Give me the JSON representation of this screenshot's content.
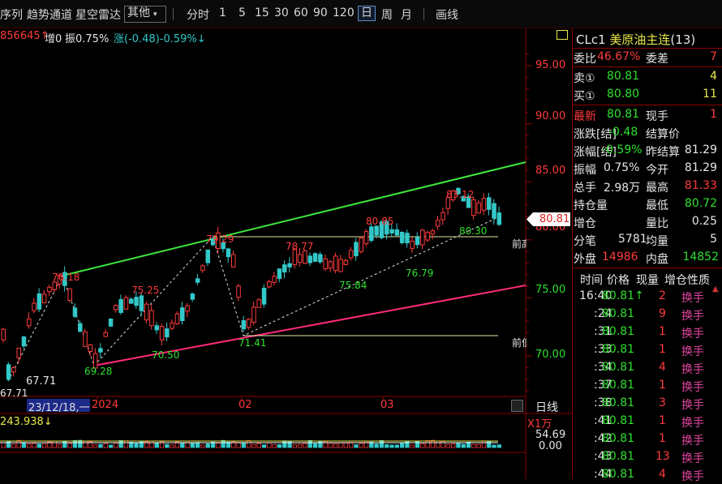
{
  "toolbar": {
    "items": [
      "序列",
      "趋势通道",
      "星空雷达"
    ],
    "other_select": "其他",
    "periods": [
      "分时",
      "1",
      "5",
      "15",
      "30",
      "60",
      "90",
      "120",
      "日",
      "周",
      "月"
    ],
    "selected_period": "日",
    "draw_label": "画线"
  },
  "info_bar": {
    "vol_label": "856645↑",
    "inc_label": "增0",
    "amp_label": "振0.75%",
    "chg_label": "涨(-0.48)-0.59%↓"
  },
  "price_axis": [
    "95.00",
    "90.00",
    "85.00",
    "80.00",
    "75.00",
    "70.00"
  ],
  "current_price_tag": "80.81",
  "front_labels": [
    "前高",
    "前低"
  ],
  "chart_annotations": [
    "76.18",
    "75.25",
    "79.29",
    "78.77",
    "80.85",
    "83.12",
    "80.30",
    "75.84",
    "76.79",
    "70.50",
    "71.41",
    "69.28",
    "67.71",
    "67.71"
  ],
  "date_axis": {
    "cursor_date": "23/12/18,一",
    "labels": [
      "2024",
      "02",
      "03"
    ]
  },
  "timeframe_label": "日线",
  "multiplier_label": "X1万",
  "volume_info": "243.938↓",
  "volume_axis": [
    "54.69",
    "0.00"
  ],
  "colors": {
    "up": "#ff3b3b",
    "down": "#33c8c8",
    "upper_channel": "#3de83d",
    "lower_channel": "#ff2a7a",
    "bg": "#000000"
  },
  "quote": {
    "symbol": "CLc1",
    "name": "美原油主连",
    "count": "(13)",
    "weibi_label": "委比",
    "weibi": "46.67%",
    "weicha_label": "委差",
    "weicha": "7",
    "sell_label": "卖①",
    "sell_price": "80.81",
    "sell_vol": "4",
    "buy_label": "买①",
    "buy_price": "80.80",
    "buy_vol": "11",
    "latest_label": "最新",
    "latest": "80.81",
    "now_hand_label": "现手",
    "now_hand": "1",
    "change_label": "涨跌[结]",
    "change": "-0.48",
    "settle_label": "结算价",
    "settle": "",
    "change_pct_label": "涨幅[结]",
    "change_pct": "-0.59%",
    "prev_settle_label": "昨结算",
    "prev_settle": "81.29",
    "amp_label": "振幅",
    "amp": "0.75%",
    "open_label": "今开",
    "open": "81.29",
    "total_label": "总手",
    "total": "2.98万",
    "high_label": "最高",
    "high": "81.33",
    "oi_label": "持仓量",
    "oi": "",
    "low_label": "最低",
    "low": "80.72",
    "inc_label": "增仓",
    "inc": "",
    "vol_ratio_label": "量比",
    "vol_ratio": "0.25",
    "trades_label": "分笔",
    "trades": "5781",
    "avg_label": "均量",
    "avg": "5",
    "outer_label": "外盘",
    "outer": "14986",
    "inner_label": "内盘",
    "inner": "14852"
  },
  "ticks": {
    "headers": [
      "时间",
      "价格",
      "现量",
      "增仓",
      "性质"
    ],
    "rows": [
      {
        "time": "16:40",
        "price": "80.81↑",
        "vol": "2",
        "nature": "换手"
      },
      {
        "time": ":24",
        "price": "80.81",
        "vol": "9",
        "nature": "换手"
      },
      {
        "time": ":31",
        "price": "80.81",
        "vol": "1",
        "nature": "换手"
      },
      {
        "time": ":33",
        "price": "80.81",
        "vol": "1",
        "nature": "换手"
      },
      {
        "time": ":34",
        "price": "80.81",
        "vol": "4",
        "nature": "换手"
      },
      {
        "time": ":37",
        "price": "80.81",
        "vol": "1",
        "nature": "换手"
      },
      {
        "time": ":38",
        "price": "80.81",
        "vol": "3",
        "nature": "换手"
      },
      {
        "time": ":41",
        "price": "80.81",
        "vol": "1",
        "nature": "换手"
      },
      {
        "time": ":42",
        "price": "80.81",
        "vol": "1",
        "nature": "换手"
      },
      {
        "time": ":43",
        "price": "80.81",
        "vol": "13",
        "nature": "换手"
      },
      {
        "time": ":44",
        "price": "80.81",
        "vol": "4",
        "nature": "换手"
      }
    ]
  }
}
